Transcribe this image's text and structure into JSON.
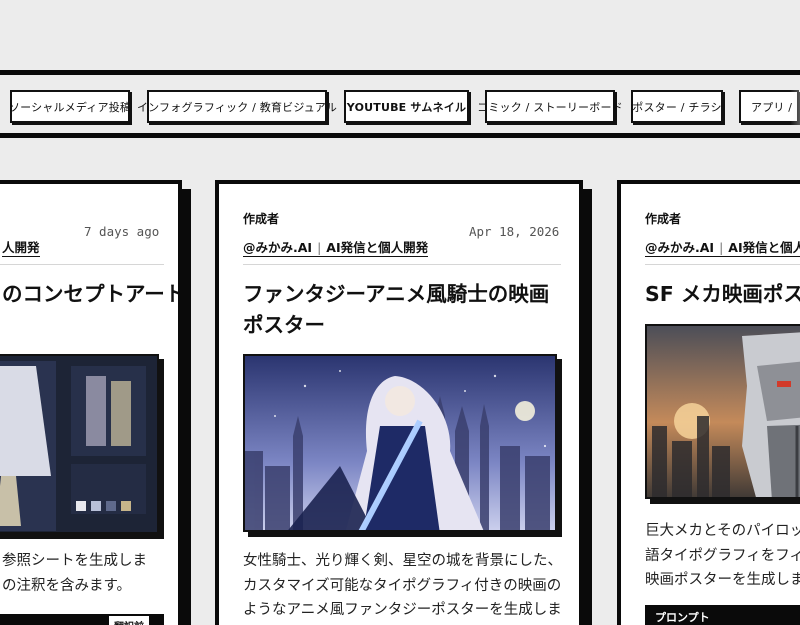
{
  "filters": [
    {
      "label": "ソーシャルメディア投稿"
    },
    {
      "label": "インフォグラフィック / 教育ビジュアル"
    },
    {
      "label": "YOUTUBE サムネイル"
    },
    {
      "label": "コミック / ストーリーボード"
    },
    {
      "label": "ポスター / チラシ"
    },
    {
      "label": "アプリ / "
    }
  ],
  "cards": [
    {
      "author_handle": "",
      "author_tag": "人開発",
      "date": "7 days ago",
      "title": "のコンセプトアート",
      "desc": "参照シートを生成しま\nの注釈を含みます。",
      "tag": "翻訳前"
    },
    {
      "creator_label": "作成者",
      "author_handle": "@みかみ.AI",
      "author_tag": "AI発信と個人開発",
      "date": "Apr 18, 2026",
      "title": "ファンタジーアニメ風騎士の映画ポスター",
      "desc": "女性騎士、光り輝く剣、星空の城を背景にした、カスタマイズ可能なタイポグラフィ付きの映画のようなアニメ風ファンタジーポスターを生成します。"
    },
    {
      "creator_label": "作成者",
      "author_handle": "@みかみ.AI",
      "author_tag": "AI発信と個人開発",
      "title": "SF メカ映画ポスター",
      "desc": "巨大メカとそのパイロット、\n語タイポグラフィをフィーチャ\n映画ポスターを生成します",
      "prompt_label": "プロンプト"
    }
  ]
}
